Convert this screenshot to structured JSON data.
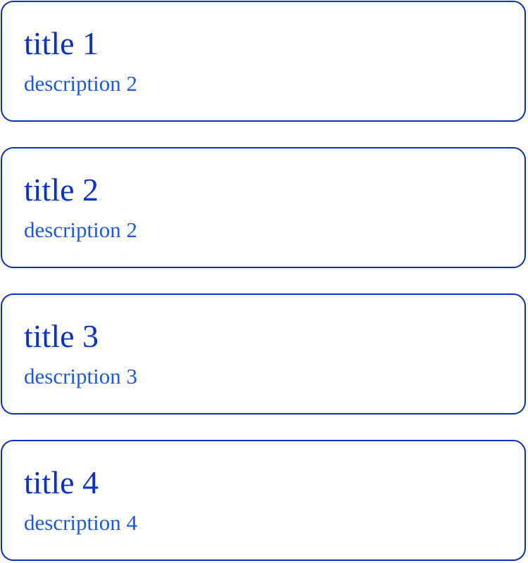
{
  "colors": {
    "border": "#0a2fb0",
    "title": "#0a32c8",
    "description": "#1a5ae6",
    "background": "#ffffff"
  },
  "cards": [
    {
      "title": "title 1",
      "description": "description 2"
    },
    {
      "title": "title 2",
      "description": "description 2"
    },
    {
      "title": "title 3",
      "description": "description 3"
    },
    {
      "title": "title 4",
      "description": "description 4"
    }
  ]
}
